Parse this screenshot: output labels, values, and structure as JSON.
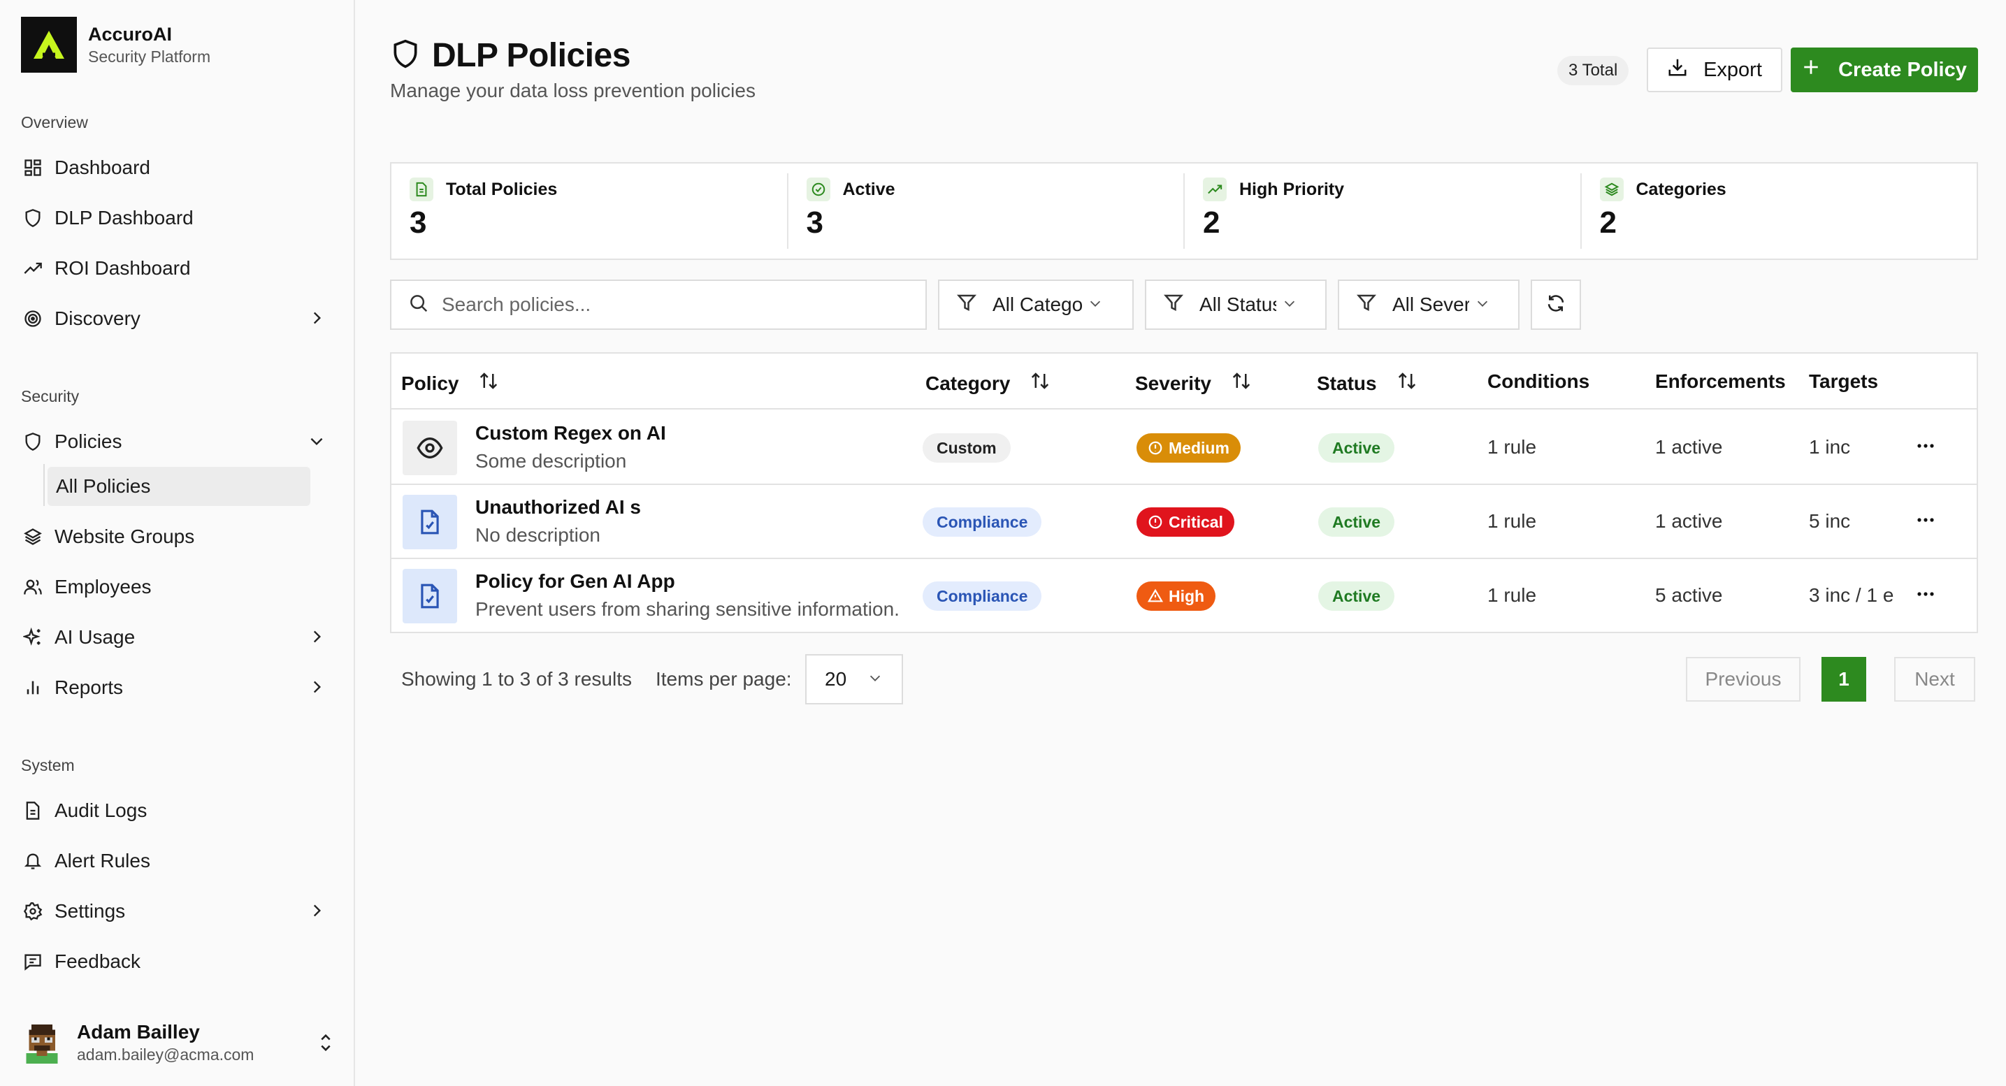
{
  "brand": {
    "name": "AccuroAI",
    "subtitle": "Security Platform"
  },
  "sidebar": {
    "sections": {
      "overview": "Overview",
      "security": "Security",
      "system": "System"
    },
    "items": {
      "dashboard": "Dashboard",
      "dlp_dashboard": "DLP Dashboard",
      "roi_dashboard": "ROI Dashboard",
      "discovery": "Discovery",
      "policies": "Policies",
      "all_policies": "All Policies",
      "website_groups": "Website Groups",
      "employees": "Employees",
      "ai_usage": "AI Usage",
      "reports": "Reports",
      "audit_logs": "Audit Logs",
      "alert_rules": "Alert Rules",
      "settings": "Settings",
      "feedback": "Feedback"
    },
    "user": {
      "name": "Adam Bailley",
      "email": "adam.bailey@acma.com"
    }
  },
  "header": {
    "title": "DLP Policies",
    "subtitle": "Manage your data loss prevention policies",
    "total_badge": "3 Total",
    "export_label": "Export",
    "create_label": "Create Policy"
  },
  "stats": [
    {
      "label": "Total Policies",
      "value": "3"
    },
    {
      "label": "Active",
      "value": "3"
    },
    {
      "label": "High Priority",
      "value": "2"
    },
    {
      "label": "Categories",
      "value": "2"
    }
  ],
  "filters": {
    "search_placeholder": "Search policies...",
    "category": "All Categories",
    "status": "All Status",
    "severity": "All Severities"
  },
  "table": {
    "columns": [
      "Policy",
      "Category",
      "Severity",
      "Status",
      "Conditions",
      "Enforcements",
      "Targets"
    ],
    "rows": [
      {
        "name": "Custom Regex on AI",
        "description": "Some description",
        "category": "Custom",
        "severity": "Medium",
        "status": "Active",
        "conditions": "1 rule",
        "enforcements": "1 active",
        "targets": "1 inc"
      },
      {
        "name": "Unauthorized AI s",
        "description": "No description",
        "category": "Compliance",
        "severity": "Critical",
        "status": "Active",
        "conditions": "1 rule",
        "enforcements": "1 active",
        "targets": "5 inc"
      },
      {
        "name": "Policy for Gen AI App",
        "description": "Prevent users from sharing sensitive information.",
        "category": "Compliance",
        "severity": "High",
        "status": "Active",
        "conditions": "1 rule",
        "enforcements": "5 active",
        "targets": "3 inc / 1 e"
      }
    ]
  },
  "pagination": {
    "showing": "Showing 1 to 3 of 3 results",
    "items_per_page_label": "Items per page:",
    "items_per_page": "20",
    "previous": "Previous",
    "current": "1",
    "next": "Next"
  },
  "colors": {
    "accent": "#2d8a1f",
    "medium": "#d98d08",
    "critical": "#e0141d",
    "high": "#ef5b12"
  }
}
